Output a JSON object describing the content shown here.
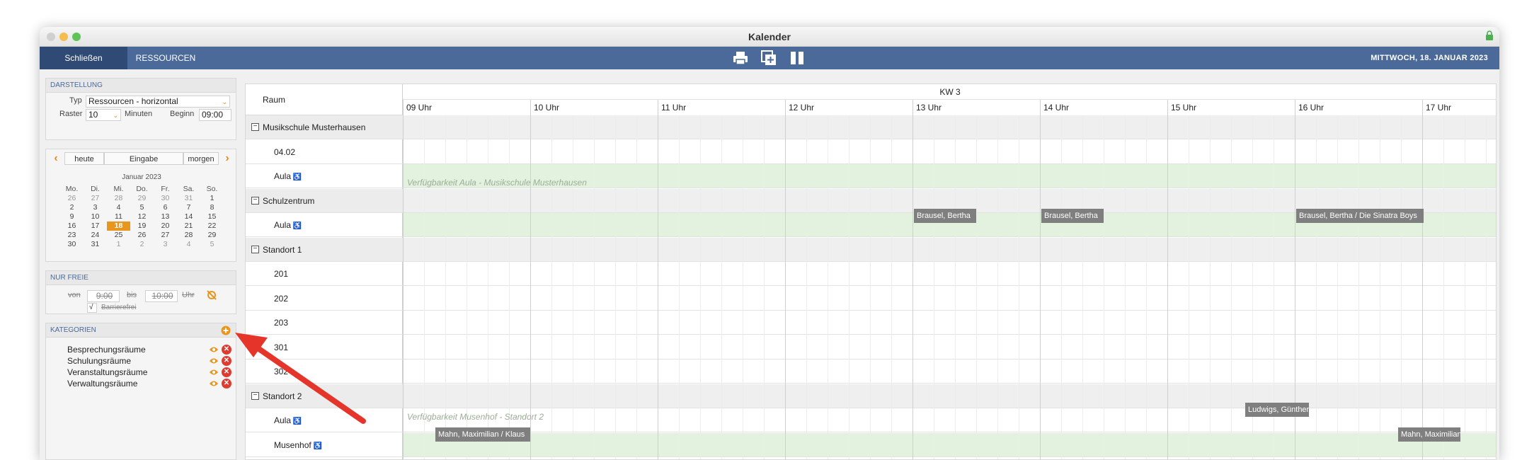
{
  "window": {
    "title": "Kalender"
  },
  "toolbar": {
    "close_label": "Schließen",
    "resources_label": "RESSOURCEN",
    "date": "MITTWOCH, 18. JANUAR 2023"
  },
  "darstellung": {
    "header": "DARSTELLUNG",
    "typ_label": "Typ",
    "typ_value": "Ressourcen - horizontal",
    "raster_label": "Raster",
    "raster_value": "10",
    "minuten_label": "Minuten",
    "beginn_label": "Beginn",
    "beginn_value": "09:00"
  },
  "calendar_nav": {
    "today": "heute",
    "entry": "Eingabe",
    "tomorrow": "morgen",
    "month_title": "Januar 2023",
    "weekdays": [
      "Mo.",
      "Di.",
      "Mi.",
      "Do.",
      "Fr.",
      "Sa.",
      "So."
    ],
    "weeks": [
      [
        "26",
        "27",
        "28",
        "29",
        "30",
        "31",
        "1"
      ],
      [
        "2",
        "3",
        "4",
        "5",
        "6",
        "7",
        "8"
      ],
      [
        "9",
        "10",
        "11",
        "12",
        "13",
        "14",
        "15"
      ],
      [
        "16",
        "17",
        "18",
        "19",
        "20",
        "21",
        "22"
      ],
      [
        "23",
        "24",
        "25",
        "26",
        "27",
        "28",
        "29"
      ],
      [
        "30",
        "31",
        "1",
        "2",
        "3",
        "4",
        "5"
      ]
    ],
    "selected_day": "18"
  },
  "nur_freie": {
    "header": "NUR FREIE",
    "von": "von",
    "von_value": "9:00",
    "bis": "bis",
    "bis_value": "10:00",
    "uhr": "Uhr",
    "checkbox_mark": "√",
    "barrierefrei": "Barrierefrei"
  },
  "kategorien": {
    "header": "KATEGORIEN",
    "items": [
      "Besprechungsräume",
      "Schulungsräume",
      "Veranstaltungsräume",
      "Verwaltungsräume"
    ]
  },
  "schedule": {
    "room_header": "Raum",
    "week_label": "KW 3",
    "hours": [
      "09 Uhr",
      "10 Uhr",
      "11 Uhr",
      "12 Uhr",
      "13 Uhr",
      "14 Uhr",
      "15 Uhr",
      "16 Uhr",
      "17 Uhr"
    ],
    "rows": [
      {
        "kind": "group",
        "label": "Musikschule Musterhausen"
      },
      {
        "kind": "item",
        "label": "04.02"
      },
      {
        "kind": "item",
        "label": "Aula"
      },
      {
        "kind": "group",
        "label": "Schulzentrum"
      },
      {
        "kind": "item",
        "label": "Aula"
      },
      {
        "kind": "group",
        "label": "Standort 1"
      },
      {
        "kind": "item",
        "label": "201"
      },
      {
        "kind": "item",
        "label": "202"
      },
      {
        "kind": "item",
        "label": "203"
      },
      {
        "kind": "item",
        "label": "301"
      },
      {
        "kind": "item",
        "label": "302"
      },
      {
        "kind": "group",
        "label": "Standort 2"
      },
      {
        "kind": "item",
        "label": "Aula"
      },
      {
        "kind": "item",
        "label": "Musenhof"
      }
    ],
    "availability": {
      "aula_musikschule": "Verfügbarkeit Aula - Musikschule Musterhausen",
      "musenhof": "Verfügbarkeit Musenhof - Standort 2"
    },
    "events": {
      "schul_1": "Brausel, Bertha",
      "schul_2": "Brausel, Bertha",
      "schul_3": "Brausel, Bertha / Die Sinatra Boys",
      "st2_aula": "Ludwigs, Günther",
      "musenhof_1": "Mahn, Maximilian / Klaus",
      "musenhof_2": "Mahn, Maximilian"
    }
  },
  "colors": {
    "toolbar": "#4b6a99",
    "accent": "#e9961e",
    "available": "#e3f2df",
    "event": "#7f7f7f",
    "arrow": "#e5352b"
  }
}
